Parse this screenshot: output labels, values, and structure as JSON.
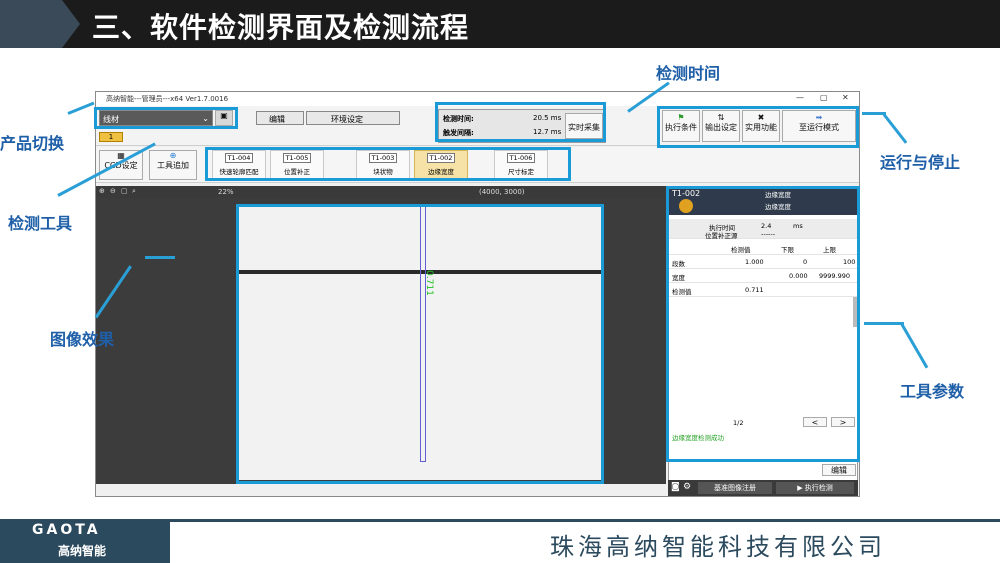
{
  "slide": {
    "title": "三、软件检测界面及检测流程",
    "annotations": {
      "product_switch": "产品切换",
      "detect_tool": "检测工具",
      "image_effect": "图像效果",
      "detect_time": "检测时间",
      "run_stop": "运行与停止",
      "tool_params": "工具参数"
    },
    "footer": {
      "logo": "GAOTA",
      "logo_cn": "高纳智能",
      "company": "珠海高纳智能科技有限公司"
    }
  },
  "app": {
    "window_title": "高纳智能---管理员---x64 Ver1.7.0016",
    "product_name": "线材",
    "edit_menu": "编辑",
    "env_menu": "环境设定",
    "detect_time_label": "检测时间:",
    "detect_time_value": "20.5 ms",
    "trigger_interval_label": "触发间隔:",
    "trigger_interval_value": "12.7 ms",
    "realtime_capture": "实时采集",
    "exec_condition": "执行条件",
    "output_setting": "输出设定",
    "utility": "实用功能",
    "to_run_mode": "至运行模式",
    "ccd_setting": "CCD设定",
    "tool_add": "工具追加",
    "tab_number": "1",
    "tools": [
      {
        "id": "T1-004",
        "name": "快速轮廓匹配"
      },
      {
        "id": "T1-005",
        "name": "位置补正"
      },
      {
        "id": "T1-003",
        "name": "块状物"
      },
      {
        "id": "T1-002",
        "name": "边缘宽度"
      },
      {
        "id": "T1-006",
        "name": "尺寸标定"
      }
    ],
    "zoom": "22%",
    "resolution": "(4000, 3000)",
    "overlay_value": "0.711",
    "panel": {
      "tool_id": "T1-002",
      "tool_title": "边缘宽度",
      "tool_subtitle": "边缘宽度",
      "exec_time_label": "执行时间",
      "exec_time_value": "2.4",
      "exec_time_unit": "ms",
      "pos_correct_label": "位置补正源",
      "pos_correct_value": "------",
      "col_measure": "检测值",
      "col_lower": "下限",
      "col_upper": "上限",
      "rows": [
        {
          "label": "段数",
          "measure": "1.000",
          "lower": "0",
          "upper": "100"
        },
        {
          "label": "宽度",
          "measure": "",
          "lower": "0.000",
          "upper": "9999.990"
        },
        {
          "label": "检测值",
          "measure": "0.711",
          "lower": "",
          "upper": ""
        }
      ],
      "page": "1/2",
      "prev": "<",
      "next": ">",
      "status_msg": "边缘宽度检测成功",
      "edit": "编辑",
      "register_image": "基准图像注册",
      "exec_detect": "执行检测"
    }
  },
  "colors": {
    "accent_blue": "#1a9ad6",
    "annotation_text": "#1f5fa8",
    "header_bg": "#1b1b1b",
    "footer_bg": "#2b4a5e"
  }
}
